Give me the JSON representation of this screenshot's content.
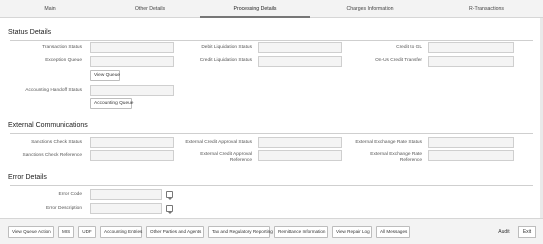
{
  "tabs": [
    "Main",
    "Other Details",
    "Processing Details",
    "Charges Information",
    "R-Transactions"
  ],
  "active_tab": "Processing Details",
  "status": {
    "title": "Status Details",
    "transaction_status": "Transaction Status",
    "exception_queue": "Exception Queue",
    "view_queue": "View Queue",
    "accounting_handoff": "Accounting Handoff Status",
    "accounting_queue": "Accounting Queue",
    "debit_liq": "Debit Liquidation Status",
    "credit_liq": "Credit Liquidation Status",
    "credit_gl": "Credit to GL",
    "onus_credit": "On-Us Credit Transfer"
  },
  "external": {
    "title": "External Communications",
    "sanctions_status": "Sanctions Check Status",
    "sanctions_ref": "Sanctions Check Reference",
    "ext_credit_status": "External Credit Approval Status",
    "ext_credit_ref": "External Credit Approval Reference",
    "ext_rate_status": "External Exchange Rate Status",
    "ext_rate_ref": "External Exchange Rate Reference"
  },
  "error": {
    "title": "Error Details",
    "code": "Error Code",
    "desc": "Error Description"
  },
  "footer": {
    "buttons": [
      "View Queue Action",
      "MIS",
      "UDF",
      "Accounting Entries",
      "Other Parties and Agents",
      "Tax and Regulatory Reporting",
      "Remittance Information",
      "View Repair Log",
      "All Messages"
    ],
    "audit": "Audit",
    "exit": "Exit"
  }
}
